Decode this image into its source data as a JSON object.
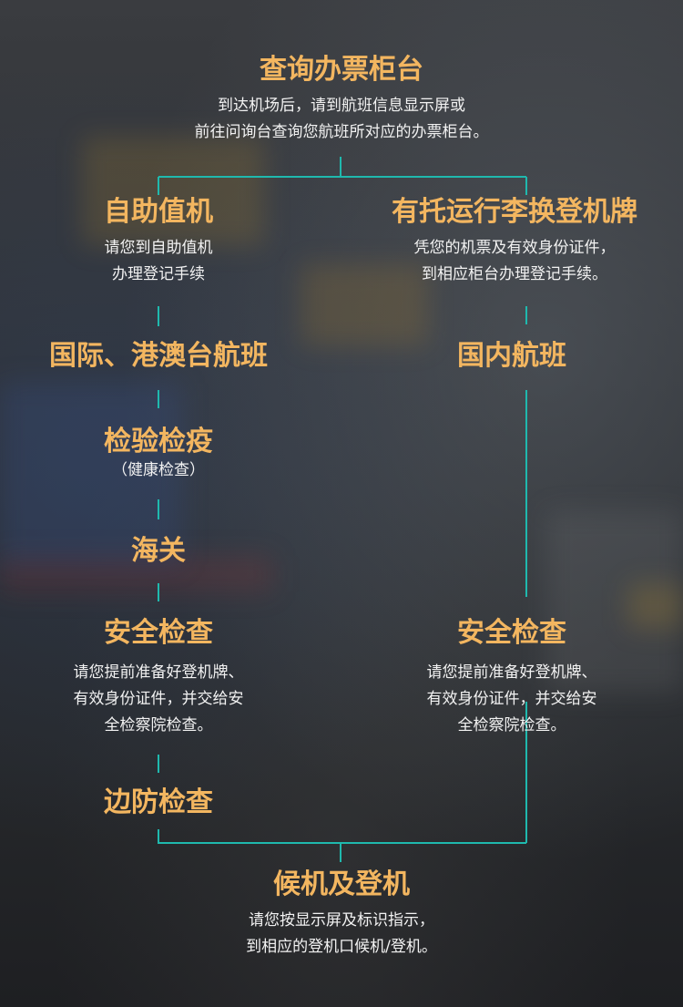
{
  "colors": {
    "title": "#f3b660",
    "line": "#1fb9ae",
    "text": "#f2f2f2"
  },
  "top": {
    "title": "查询办票柜台",
    "desc": [
      "到达机场后，请到航班信息显示屏或",
      "前往问询台查询您航班所对应的办票柜台。"
    ]
  },
  "left": {
    "self_checkin": {
      "title": "自助值机",
      "desc": [
        "请您到自助值机",
        "办理登记手续"
      ]
    },
    "intl": {
      "title": "国际、港澳台航班"
    },
    "quarantine": {
      "title": "检验检疫",
      "sub": "（健康检查）"
    },
    "customs": {
      "title": "海关"
    },
    "security": {
      "title": "安全检查",
      "desc": [
        "请您提前准备好登机牌、",
        "有效身份证件，并交给安",
        "全检察院检查。"
      ]
    },
    "border": {
      "title": "边防检查"
    }
  },
  "right": {
    "baggage": {
      "title": "有托运行李换登机牌",
      "desc": [
        "凭您的机票及有效身份证件，",
        "到相应柜台办理登记手续。"
      ]
    },
    "domestic": {
      "title": "国内航班"
    },
    "security": {
      "title": "安全检查",
      "desc": [
        "请您提前准备好登机牌、",
        "有效身份证件，并交给安",
        "全检察院检查。"
      ]
    }
  },
  "bottom": {
    "title": "候机及登机",
    "desc": [
      "请您按显示屏及标识指示，",
      "到相应的登机口候机/登机。"
    ]
  }
}
